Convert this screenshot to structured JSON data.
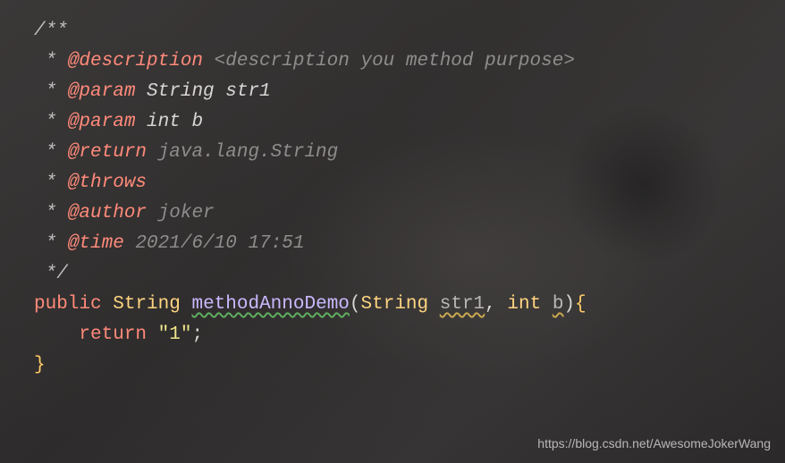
{
  "code": {
    "l1": "/**",
    "l2_star": " * ",
    "l2_tag": "@description",
    "l2_rest": " <description you method purpose>",
    "l3_star": " * ",
    "l3_tag": "@param",
    "l3_rest": " String str1",
    "l4_star": " * ",
    "l4_tag": "@param",
    "l4_rest": " int b",
    "l5_star": " * ",
    "l5_tag": "@return",
    "l5_rest": " java.lang.String",
    "l6_star": " * ",
    "l6_tag": "@throws",
    "l7_star": " * ",
    "l7_tag": "@author",
    "l7_rest": " joker",
    "l8_star": " * ",
    "l8_tag": "@time",
    "l8_rest": " 2021/6/10 17:51",
    "l9": " */",
    "l10_mod": "public",
    "l10_type": "String",
    "l10_method": "methodAnnoDemo",
    "l10_p1type": "String",
    "l10_p1name": "str1",
    "l10_p2type": "int",
    "l10_p2name": "b",
    "l11_ret": "return",
    "l11_str": "\"1\"",
    "l12_brace": "}"
  },
  "watermark": "https://blog.csdn.net/AwesomeJokerWang"
}
